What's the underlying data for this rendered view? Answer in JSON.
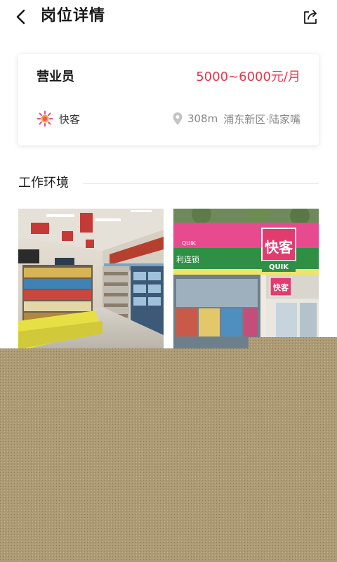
{
  "header": {
    "title": "岗位详情",
    "back_icon": "chevron-left-icon",
    "share_icon": "share-icon"
  },
  "job": {
    "title": "营业员",
    "salary": "5000~6000元/月",
    "company_name": "快客",
    "distance": "308m",
    "address": "浦东新区·陆家嘴"
  },
  "environment": {
    "section_title": "工作环境",
    "photos": [
      {
        "desc": "store-interior-photo"
      },
      {
        "desc": "store-front-photo",
        "sign_text": "快客",
        "brand_text": "QUIK",
        "chain_text": "利连锁",
        "small_sign": "快客"
      }
    ]
  },
  "colors": {
    "accent": "#e8364a",
    "overlay": "#ad9b75"
  }
}
